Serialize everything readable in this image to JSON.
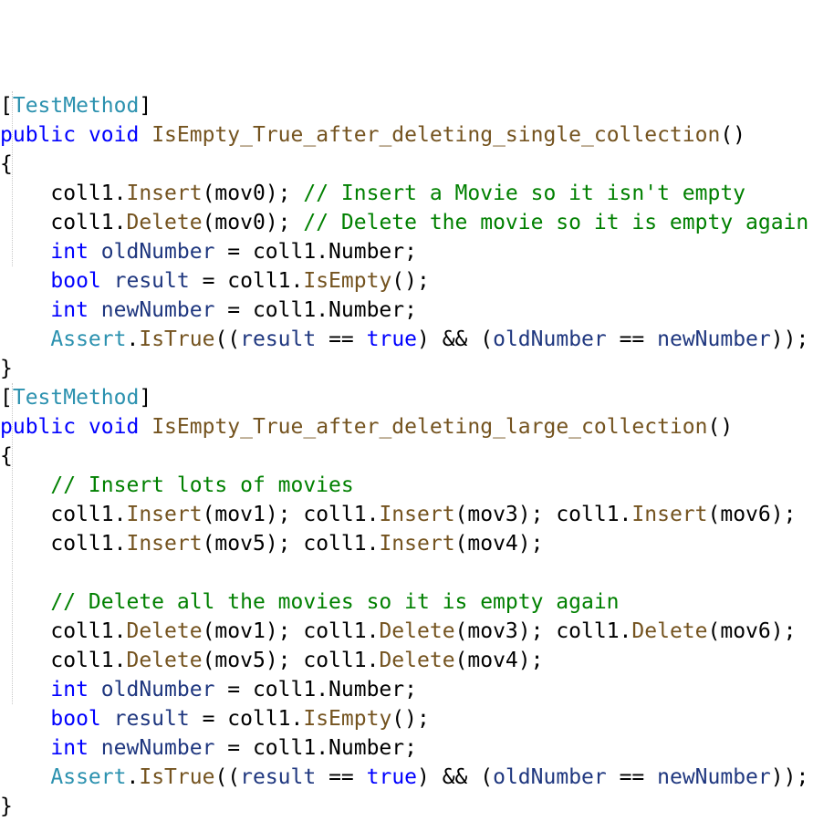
{
  "colors": {
    "keyword": "#0000ff",
    "type": "#2b91af",
    "method": "#74531f",
    "comment": "#008000",
    "local": "#1f377f",
    "plain": "#000000",
    "background": "#ffffff"
  },
  "lines": [
    [
      [
        "plain",
        "["
      ],
      [
        "type",
        "TestMethod"
      ],
      [
        "plain",
        "]"
      ]
    ],
    [
      [
        "keyword",
        "public"
      ],
      [
        "plain",
        " "
      ],
      [
        "keyword",
        "void"
      ],
      [
        "plain",
        " "
      ],
      [
        "method",
        "IsEmpty_True_after_deleting_single_collection"
      ],
      [
        "plain",
        "()"
      ]
    ],
    [
      [
        "plain",
        "{"
      ]
    ],
    [
      [
        "plain",
        "    coll1."
      ],
      [
        "method",
        "Insert"
      ],
      [
        "plain",
        "(mov0); "
      ],
      [
        "comment",
        "// Insert a Movie so it isn't empty"
      ]
    ],
    [
      [
        "plain",
        "    coll1."
      ],
      [
        "method",
        "Delete"
      ],
      [
        "plain",
        "(mov0); "
      ],
      [
        "comment",
        "// Delete the movie so it is empty again"
      ]
    ],
    [
      [
        "plain",
        "    "
      ],
      [
        "keyword",
        "int"
      ],
      [
        "plain",
        " "
      ],
      [
        "local",
        "oldNumber"
      ],
      [
        "plain",
        " = coll1.Number;"
      ]
    ],
    [
      [
        "plain",
        "    "
      ],
      [
        "keyword",
        "bool"
      ],
      [
        "plain",
        " "
      ],
      [
        "local",
        "result"
      ],
      [
        "plain",
        " = coll1."
      ],
      [
        "method",
        "IsEmpty"
      ],
      [
        "plain",
        "();"
      ]
    ],
    [
      [
        "plain",
        "    "
      ],
      [
        "keyword",
        "int"
      ],
      [
        "plain",
        " "
      ],
      [
        "local",
        "newNumber"
      ],
      [
        "plain",
        " = coll1.Number;"
      ]
    ],
    [
      [
        "plain",
        "    "
      ],
      [
        "type",
        "Assert"
      ],
      [
        "plain",
        "."
      ],
      [
        "method",
        "IsTrue"
      ],
      [
        "plain",
        "(("
      ],
      [
        "local",
        "result"
      ],
      [
        "plain",
        " == "
      ],
      [
        "keyword",
        "true"
      ],
      [
        "plain",
        ") && ("
      ],
      [
        "local",
        "oldNumber"
      ],
      [
        "plain",
        " == "
      ],
      [
        "local",
        "newNumber"
      ],
      [
        "plain",
        "));"
      ]
    ],
    [
      [
        "plain",
        "}"
      ]
    ],
    [
      [
        "plain",
        "["
      ],
      [
        "type",
        "TestMethod"
      ],
      [
        "plain",
        "]"
      ]
    ],
    [
      [
        "keyword",
        "public"
      ],
      [
        "plain",
        " "
      ],
      [
        "keyword",
        "void"
      ],
      [
        "plain",
        " "
      ],
      [
        "method",
        "IsEmpty_True_after_deleting_large_collection"
      ],
      [
        "plain",
        "()"
      ]
    ],
    [
      [
        "plain",
        "{"
      ]
    ],
    [
      [
        "plain",
        "    "
      ],
      [
        "comment",
        "// Insert lots of movies"
      ]
    ],
    [
      [
        "plain",
        "    coll1."
      ],
      [
        "method",
        "Insert"
      ],
      [
        "plain",
        "(mov1); coll1."
      ],
      [
        "method",
        "Insert"
      ],
      [
        "plain",
        "(mov3); coll1."
      ],
      [
        "method",
        "Insert"
      ],
      [
        "plain",
        "(mov6);"
      ]
    ],
    [
      [
        "plain",
        "    coll1."
      ],
      [
        "method",
        "Insert"
      ],
      [
        "plain",
        "(mov5); coll1."
      ],
      [
        "method",
        "Insert"
      ],
      [
        "plain",
        "(mov4);"
      ]
    ],
    [],
    [
      [
        "plain",
        "    "
      ],
      [
        "comment",
        "// Delete all the movies so it is empty again"
      ]
    ],
    [
      [
        "plain",
        "    coll1."
      ],
      [
        "method",
        "Delete"
      ],
      [
        "plain",
        "(mov1); coll1."
      ],
      [
        "method",
        "Delete"
      ],
      [
        "plain",
        "(mov3); coll1."
      ],
      [
        "method",
        "Delete"
      ],
      [
        "plain",
        "(mov6);"
      ]
    ],
    [
      [
        "plain",
        "    coll1."
      ],
      [
        "method",
        "Delete"
      ],
      [
        "plain",
        "(mov5); coll1."
      ],
      [
        "method",
        "Delete"
      ],
      [
        "plain",
        "(mov4);"
      ]
    ],
    [
      [
        "plain",
        "    "
      ],
      [
        "keyword",
        "int"
      ],
      [
        "plain",
        " "
      ],
      [
        "local",
        "oldNumber"
      ],
      [
        "plain",
        " = coll1.Number;"
      ]
    ],
    [
      [
        "plain",
        "    "
      ],
      [
        "keyword",
        "bool"
      ],
      [
        "plain",
        " "
      ],
      [
        "local",
        "result"
      ],
      [
        "plain",
        " = coll1."
      ],
      [
        "method",
        "IsEmpty"
      ],
      [
        "plain",
        "();"
      ]
    ],
    [
      [
        "plain",
        "    "
      ],
      [
        "keyword",
        "int"
      ],
      [
        "plain",
        " "
      ],
      [
        "local",
        "newNumber"
      ],
      [
        "plain",
        " = coll1.Number;"
      ]
    ],
    [
      [
        "plain",
        "    "
      ],
      [
        "type",
        "Assert"
      ],
      [
        "plain",
        "."
      ],
      [
        "method",
        "IsTrue"
      ],
      [
        "plain",
        "(("
      ],
      [
        "local",
        "result"
      ],
      [
        "plain",
        " == "
      ],
      [
        "keyword",
        "true"
      ],
      [
        "plain",
        ") && ("
      ],
      [
        "local",
        "oldNumber"
      ],
      [
        "plain",
        " == "
      ],
      [
        "local",
        "newNumber"
      ],
      [
        "plain",
        "));"
      ]
    ],
    [
      [
        "plain",
        "}"
      ]
    ]
  ]
}
